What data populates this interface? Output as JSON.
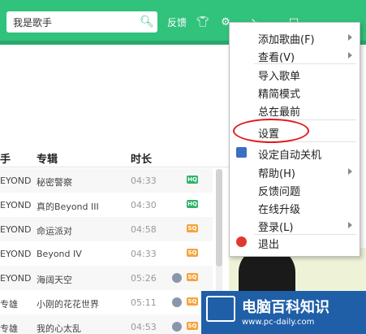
{
  "header": {
    "search_value": "我是歌手",
    "feedback_label": "反馈",
    "colors": {
      "accent": "#31c27c",
      "dark": "#2aa86b"
    }
  },
  "table": {
    "headers": {
      "artist": "手",
      "album": "专辑",
      "duration": "时长"
    },
    "rows": [
      {
        "artist": "EYOND",
        "album": "秘密警察",
        "time": "04:33",
        "badge": "HQ",
        "globe": false
      },
      {
        "artist": "EYOND",
        "album": "真的Beyond III",
        "time": "04:30",
        "badge": "HQ",
        "globe": false
      },
      {
        "artist": "EYOND",
        "album": "命运派对",
        "time": "04:58",
        "badge": "SQ",
        "globe": false
      },
      {
        "artist": "EYOND",
        "album": "Beyond IV",
        "time": "04:33",
        "badge": "SQ",
        "globe": false
      },
      {
        "artist": "EYOND",
        "album": "海阔天空",
        "time": "05:26",
        "badge": "SQ",
        "globe": true
      },
      {
        "artist": "专雄",
        "album": "小刚的花花世界",
        "time": "05:11",
        "badge": "SQ",
        "globe": true
      },
      {
        "artist": "专雄",
        "album": "我的心太乱",
        "time": "04:53",
        "badge": "SQ",
        "globe": true
      }
    ]
  },
  "menu": {
    "items": [
      {
        "label": "添加歌曲(F)",
        "submenu": true,
        "icon": ""
      },
      {
        "label": "查看(V)",
        "submenu": true,
        "icon": ""
      },
      {
        "label": "导入歌单",
        "submenu": false,
        "icon": ""
      },
      {
        "label": "精简模式",
        "submenu": false,
        "icon": ""
      },
      {
        "label": "总在最前",
        "submenu": false,
        "icon": ""
      },
      {
        "label": "设置",
        "submenu": false,
        "icon": ""
      },
      {
        "label": "设定自动关机",
        "submenu": false,
        "icon": "shutdown-icon"
      },
      {
        "label": "帮助(H)",
        "submenu": true,
        "icon": ""
      },
      {
        "label": "反馈问题",
        "submenu": false,
        "icon": ""
      },
      {
        "label": "在线升级",
        "submenu": false,
        "icon": ""
      },
      {
        "label": "登录(L)",
        "submenu": true,
        "icon": ""
      },
      {
        "label": "退出",
        "submenu": false,
        "icon": "exit-icon"
      }
    ],
    "highlight_color": "#e01a1a"
  },
  "watermark": {
    "title": "电脑百科知识",
    "url": "www.pc-daily.com"
  }
}
